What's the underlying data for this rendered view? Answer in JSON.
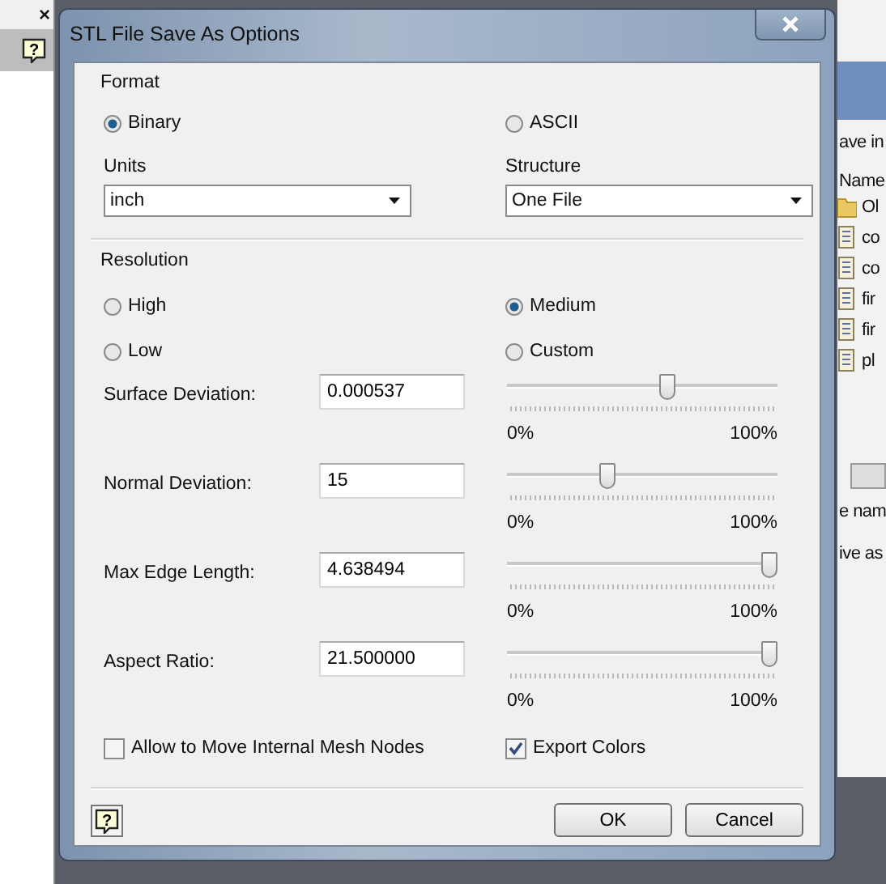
{
  "background_app": {
    "left_panel": {
      "close_glyph": "×",
      "help_glyph": "?"
    },
    "right_panel": {
      "save_in_label": "ave in",
      "name_header": "Name",
      "files": [
        {
          "kind": "folder",
          "name": "Ol"
        },
        {
          "kind": "file",
          "name": "co"
        },
        {
          "kind": "file",
          "name": "co"
        },
        {
          "kind": "file",
          "name": "fir"
        },
        {
          "kind": "file",
          "name": "fir"
        },
        {
          "kind": "file",
          "name": "pl"
        }
      ],
      "file_name_label": "e nam",
      "save_as_label": "ive as"
    }
  },
  "dialog": {
    "title": "STL File Save As Options",
    "format": {
      "label": "Format",
      "options": [
        {
          "label": "Binary",
          "selected": true
        },
        {
          "label": "ASCII",
          "selected": false
        }
      ],
      "units": {
        "label": "Units",
        "value": "inch"
      },
      "structure": {
        "label": "Structure",
        "value": "One File"
      }
    },
    "resolution": {
      "label": "Resolution",
      "options": [
        {
          "label": "High",
          "selected": false
        },
        {
          "label": "Medium",
          "selected": true
        },
        {
          "label": "Low",
          "selected": false
        },
        {
          "label": "Custom",
          "selected": false
        }
      ],
      "parameters": [
        {
          "label": "Surface Deviation:",
          "value": "0.000537",
          "level": 0.6,
          "min_label": "0%",
          "max_label": "100%"
        },
        {
          "label": "Normal Deviation:",
          "value": "15",
          "level": 0.36,
          "min_label": "0%",
          "max_label": "100%"
        },
        {
          "label": "Max Edge Length:",
          "value": "4.638494",
          "level": 1,
          "min_label": "0%",
          "max_label": "100%"
        },
        {
          "label": "Aspect Ratio:",
          "value": "21.500000",
          "level": 1,
          "min_label": "0%",
          "max_label": "100%"
        }
      ]
    },
    "checkboxes": [
      {
        "label": "Allow to Move Internal Mesh Nodes",
        "checked": false
      },
      {
        "label": "Export Colors",
        "checked": true
      }
    ],
    "help_glyph": "?",
    "buttons": [
      {
        "label": "OK"
      },
      {
        "label": "Cancel"
      }
    ]
  }
}
